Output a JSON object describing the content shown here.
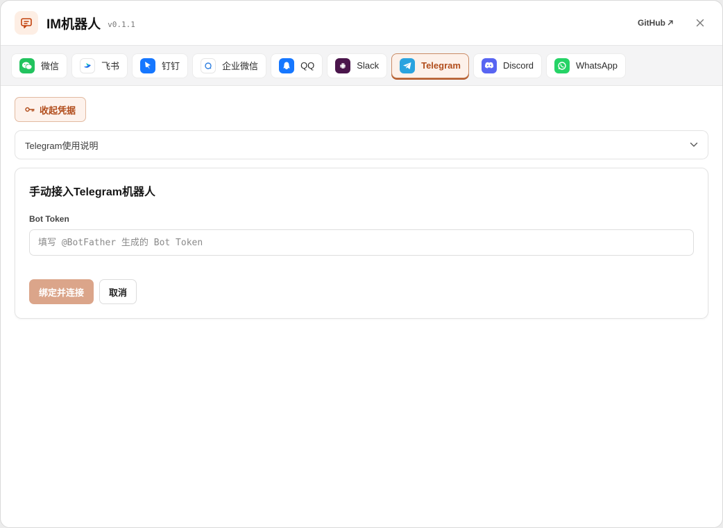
{
  "app": {
    "title": "IM机器人",
    "version": "v0.1.1",
    "github_label": "GitHub",
    "accent": "#b14d1c"
  },
  "tabs": [
    {
      "label": "微信",
      "icon": "wechat-icon",
      "color": "#22c35e",
      "active": false
    },
    {
      "label": "飞书",
      "icon": "feishu-icon",
      "color": "#ffffff",
      "active": false
    },
    {
      "label": "钉钉",
      "icon": "dingtalk-icon",
      "color": "#1677ff",
      "active": false
    },
    {
      "label": "企业微信",
      "icon": "wecom-icon",
      "color": "#ffffff",
      "active": false
    },
    {
      "label": "QQ",
      "icon": "qq-icon",
      "color": "#1677ff",
      "active": false
    },
    {
      "label": "Slack",
      "icon": "slack-icon",
      "color": "#4a154b",
      "active": false
    },
    {
      "label": "Telegram",
      "icon": "telegram-icon",
      "color": "#2aa3df",
      "active": true
    },
    {
      "label": "Discord",
      "icon": "discord-icon",
      "color": "#5865f2",
      "active": false
    },
    {
      "label": "WhatsApp",
      "icon": "whatsapp-icon",
      "color": "#25d366",
      "active": false
    }
  ],
  "content": {
    "collapse_label": "收起凭据",
    "guide_label": "Telegram使用说明",
    "card": {
      "title": "手动接入Telegram机器人",
      "field_label": "Bot Token",
      "placeholder": "填写 @BotFather 生成的 Bot Token",
      "value": "",
      "primary_label": "绑定并连接",
      "cancel_label": "取消"
    }
  }
}
